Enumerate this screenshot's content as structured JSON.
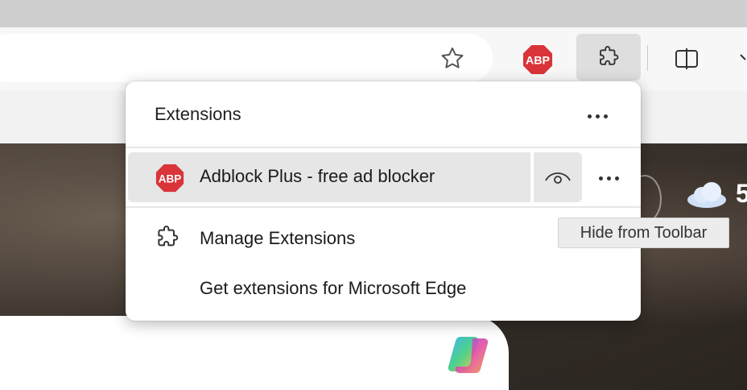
{
  "toolbar": {
    "bookmark_icon": "star-outline-icon",
    "abp_badge_text": "ABP",
    "extensions_icon": "puzzle-icon",
    "split_icon": "split-screen-icon"
  },
  "popup": {
    "title": "Extensions",
    "more_icon": "more-horizontal-icon",
    "extensions": [
      {
        "name": "Adblock Plus - free ad blocker",
        "badge_text": "ABP",
        "visibility_icon": "eye-icon",
        "more_icon": "more-horizontal-icon"
      }
    ],
    "manage_label": "Manage Extensions",
    "get_label": "Get extensions for Microsoft Edge"
  },
  "tooltip": {
    "text": "Hide from Toolbar"
  },
  "background": {
    "weather_temp": "5"
  },
  "colors": {
    "abp_red": "#d9343a",
    "hover_gray": "#e6e6e6",
    "toolbar_active": "#dedede"
  }
}
